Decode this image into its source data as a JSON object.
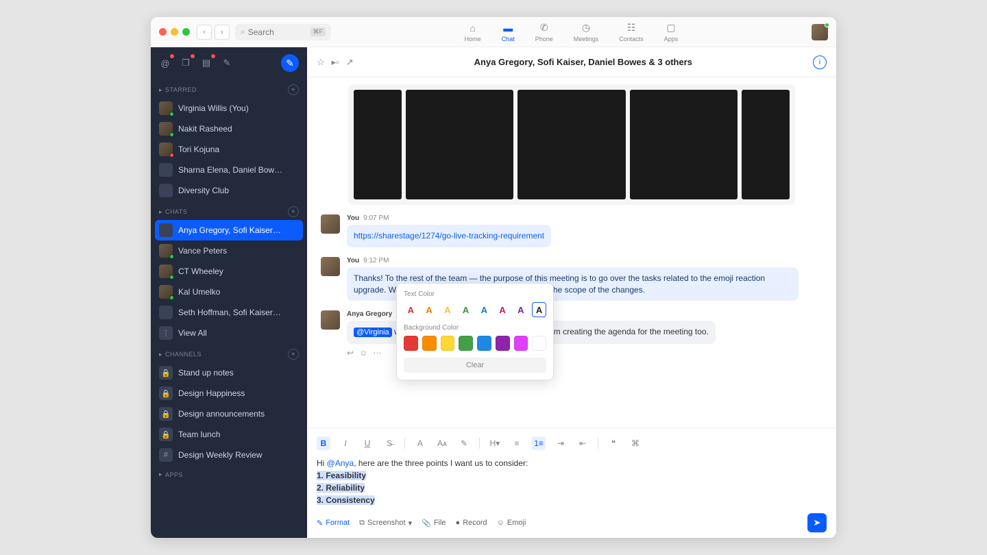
{
  "titlebar": {
    "search_placeholder": "Search",
    "kbd": "⌘F"
  },
  "topnav": {
    "items": [
      {
        "label": "Home",
        "icon": "⌂"
      },
      {
        "label": "Chat",
        "icon": "💬"
      },
      {
        "label": "Phone",
        "icon": "✆"
      },
      {
        "label": "Meetings",
        "icon": "◷"
      },
      {
        "label": "Contacts",
        "icon": "☷"
      },
      {
        "label": "Apps",
        "icon": "▢"
      }
    ],
    "active_index": 1
  },
  "sidebar": {
    "sections": {
      "starred": {
        "title": "Starred",
        "items": [
          {
            "label": "Virginia Willis (You)",
            "status": "green"
          },
          {
            "label": "Nakit Rasheed",
            "status": "green"
          },
          {
            "label": "Tori Kojuna",
            "status": "red"
          },
          {
            "label": "Sharna Elena, Daniel Bow…",
            "multi": true
          },
          {
            "label": "Diversity Club",
            "multi": true
          }
        ]
      },
      "chats": {
        "title": "Chats",
        "items": [
          {
            "label": "Anya Gregory, Sofi Kaiser…",
            "multi": true,
            "active": true
          },
          {
            "label": "Vance Peters",
            "status": "green"
          },
          {
            "label": "CT Wheeley",
            "status": "green"
          },
          {
            "label": "Kal Umelko",
            "status": "green"
          },
          {
            "label": "Seth Hoffman, Sofi Kaiser…",
            "multi": true
          },
          {
            "label": "View All",
            "viewall": true
          }
        ]
      },
      "channels": {
        "title": "Channels",
        "items": [
          {
            "label": "Stand up notes"
          },
          {
            "label": "Design Happiness"
          },
          {
            "label": "Design announcements"
          },
          {
            "label": "Team lunch"
          },
          {
            "label": "Design Weekly Review"
          }
        ]
      },
      "apps": {
        "title": "Apps"
      }
    }
  },
  "chat": {
    "title": "Anya Gregory, Sofi Kaiser, Daniel Bowes & 3 others",
    "messages": {
      "m1": {
        "sender": "You",
        "time": "9:07 PM",
        "link": "https://sharestage/1274/go-live-tracking-requirement"
      },
      "m2": {
        "sender": "You",
        "time": "9:12 PM",
        "text": "Thanks! To the rest of the team — the purpose of this meeting is to go over the tasks related to the emoji reaction upgrade. We'll review what needs to be designed and the scope of the changes."
      },
      "m3": {
        "sender": "Anya Gregory",
        "mention": "@Virginia",
        "text_after": " what are the points you want to go over? I am creating the agenda for the meeting too."
      }
    }
  },
  "color_popover": {
    "text_label": "Text Color",
    "bg_label": "Background Color",
    "clear": "Clear",
    "text_colors": [
      "#d32f2f",
      "#f57c00",
      "#fbc02d",
      "#388e3c",
      "#1976d2",
      "#c2185b",
      "#7b1fa2",
      "#212121"
    ],
    "bg_colors": [
      "#e53935",
      "#fb8c00",
      "#fdd835",
      "#43a047",
      "#1e88e5",
      "#8e24aa",
      "#e040fb",
      "#ffffff"
    ]
  },
  "composer": {
    "line1_prefix": "Hi ",
    "line1_mention": "@Anya",
    "line1_suffix": ", here are the three points I want us to consider:",
    "points": [
      "1. Feasibility",
      "2. Reliability",
      "3. Consistency"
    ],
    "footer": {
      "format": "Format",
      "screenshot": "Screenshot",
      "file": "File",
      "record": "Record",
      "emoji": "Emoji"
    }
  }
}
